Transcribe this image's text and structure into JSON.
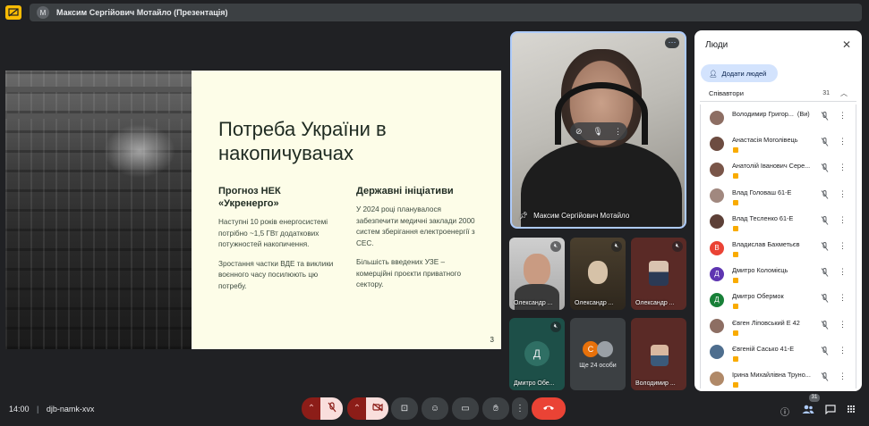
{
  "presentation": {
    "presenter_initial": "М",
    "title": "Максим Сергійович Мотайло (Презентація)"
  },
  "slide": {
    "title": "Потреба України в накопичувачах",
    "col1": {
      "heading": "Прогноз НЕК «Укренерго»",
      "p1": "Наступні 10 років енергосистемі потрібно ~1,5 ГВт додаткових потужностей накопичення.",
      "p2": "Зростання частки ВДЕ та виклики воєнного часу посилюють цю потребу."
    },
    "col2": {
      "heading": "Державні ініціативи",
      "p1": "У 2024 році планувалося забезпечити медичні заклади 2000 систем зберігання електроенергії з СЕС.",
      "p2": "Більшість введених УЗЕ – комерційні проєкти приватного сектору."
    },
    "page_number": "3"
  },
  "main_tile": {
    "name": "Максим Сергійович Мотайло",
    "more": "⋯"
  },
  "tiles": [
    {
      "name": "Олександр ..."
    },
    {
      "name": "Олександр ..."
    },
    {
      "name": "Олександр ..."
    },
    {
      "name": "Дмитро Обе...",
      "initial": "Д"
    },
    {
      "others_label": "Ще 24 особи",
      "initial": "С"
    },
    {
      "name": "Володимир ..."
    }
  ],
  "people_panel": {
    "title": "Люди",
    "add_label": "Додати людей",
    "section_label": "Співавтори",
    "section_count": "31",
    "people": [
      {
        "name": "Володимир Григор...",
        "suffix": "(Ви)",
        "initial": "",
        "color": "#8d6e63"
      },
      {
        "name": "Анастасія Моголівець",
        "initial": "",
        "color": "#6d4c41"
      },
      {
        "name": "Анатолій Іванович Сере...",
        "initial": "",
        "color": "#795548"
      },
      {
        "name": "Влад Головаш 61-Е",
        "initial": "",
        "color": "#a1887f"
      },
      {
        "name": "Влад Тесленко 61-Е",
        "initial": "",
        "color": "#5d4037"
      },
      {
        "name": "Владислав Бахметьєв",
        "initial": "В",
        "color": "#ea4335"
      },
      {
        "name": "Дмитро Коломієць",
        "initial": "Д",
        "color": "#5e35b1"
      },
      {
        "name": "Дмитро Обермок",
        "initial": "Д",
        "color": "#188038"
      },
      {
        "name": "Євген Ліповський Е 42",
        "initial": "",
        "color": "#8d6e63"
      },
      {
        "name": "Євгеній Сасько 41-Е",
        "initial": "",
        "color": "#4e6e8e"
      },
      {
        "name": "Ірина Михайлівна Труно...",
        "initial": "",
        "color": "#b08968"
      }
    ]
  },
  "footer": {
    "time": "14:00",
    "meeting_code": "djb-namk-xvx",
    "people_count": "31"
  },
  "colors": {
    "hangup": "#ea4335",
    "accent_blue": "#aecbfa",
    "present_yellow": "#fbbc04"
  }
}
